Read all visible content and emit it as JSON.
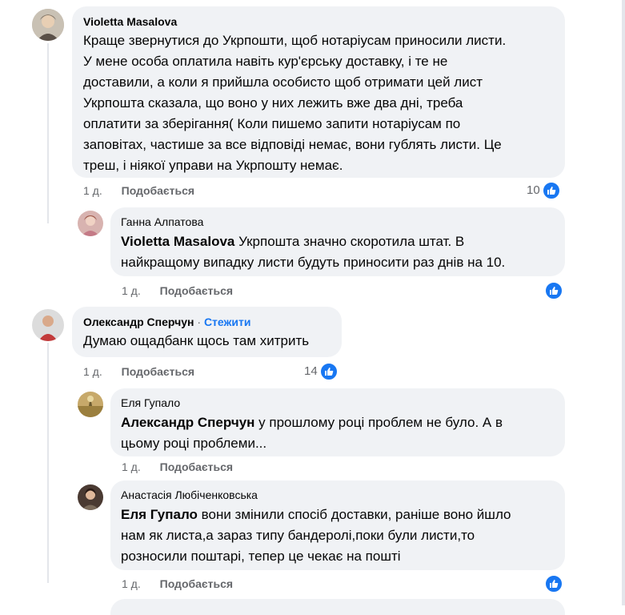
{
  "comments": [
    {
      "author": "Violetta Masalova",
      "text": "Краще звернутися до Укрпошти, щоб нотаріусам приносили листи.\nУ мене особа оплатила навіть кур'єрську доставку, і те не\nдоставили, а коли я прийшла особисто щоб отримати цей лист\nУкрпошта сказала, що воно у них лежить вже два дні, треба\nоплатити за зберігання( Коли пишемо запити нотаріусам по\nзаповітах, частише за все відповіді немає, вони гублять листи. Це\nтреш, і ніякої управи на Укрпошту немає.",
      "time": "1 д.",
      "like_label": "Подобається",
      "reactions": "10"
    },
    {
      "author": "Ганна Алпатова",
      "mention": "Violetta Masalova",
      "text": " Укрпошта значно скоротила штат. В\nнайкращому випадку листи будуть приносити раз днів на 10.",
      "time": "1 д.",
      "like_label": "Подобається",
      "reactions": ""
    },
    {
      "author": "Олександр Сперчун",
      "follow_sep": " · ",
      "follow": "Стежити",
      "text": "Думаю ощадбанк щось там хитрить",
      "time": "1 д.",
      "like_label": "Подобається",
      "reactions": "14"
    },
    {
      "author": "Еля Гупало",
      "mention": "Александр Сперчун",
      "text": " у прошлому році проблем не було. А в\nцьому році проблеми...",
      "time": "1 д.",
      "like_label": "Подобається",
      "reactions": ""
    },
    {
      "author": "Анастасія Любіченковська",
      "mention": "Еля Гупало",
      "text": " вони змінили спосіб доставки, раніше воно йшло\nнам як листа,а зараз типу бандеролі,поки були листи,то\nрозносили поштарі, тепер це чекає на пошті",
      "time": "1 д.",
      "like_label": "Подобається",
      "reactions": ""
    }
  ],
  "colors": {
    "bubble": "#f0f2f5",
    "link": "#1877f2",
    "muted": "#65676b",
    "like_blue": "#1877f2"
  },
  "icons": [
    "like-reaction-icon",
    "avatar"
  ]
}
